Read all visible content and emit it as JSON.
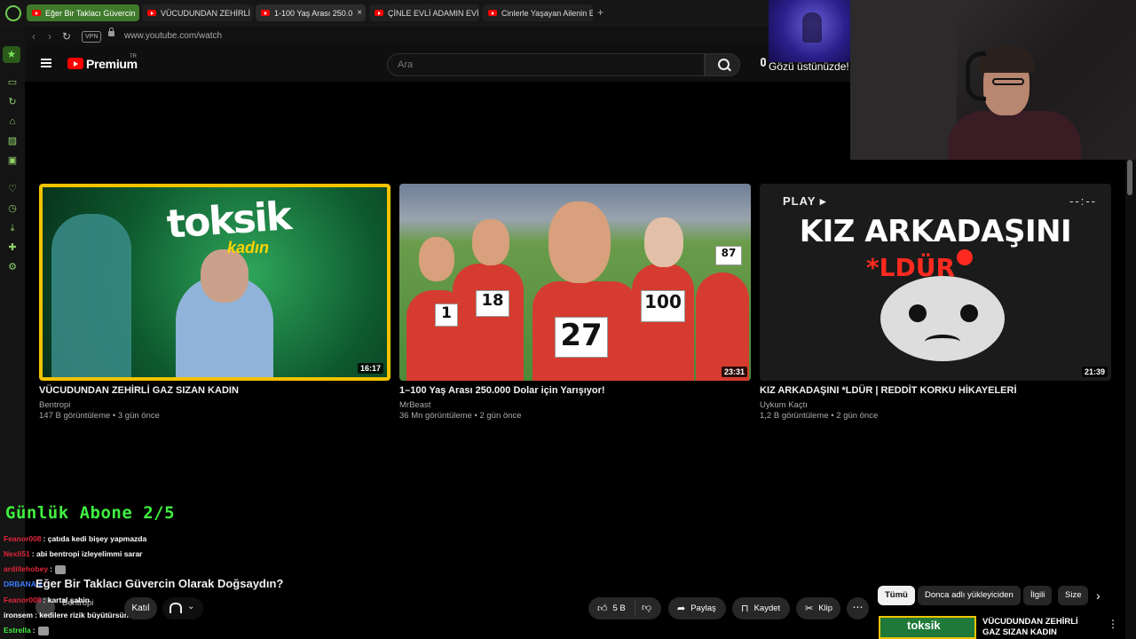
{
  "browser": {
    "tabs": [
      {
        "label": "Eğer Bir Taklacı Güvercin",
        "state": "green"
      },
      {
        "label": "VÜCUDUNDAN ZEHİRLİ G",
        "state": "normal"
      },
      {
        "label": "1-100 Yaş Arası 250.0",
        "state": "active"
      },
      {
        "label": "ÇİNLE EVLİ ADAMIN EVİN",
        "state": "normal"
      },
      {
        "label": "Cinlerle Yaşayan Ailenin E",
        "state": "normal"
      }
    ],
    "close_glyph": "×",
    "new_tab_glyph": "+",
    "vpn_label": "VPN",
    "url": "www.youtube.com/watch"
  },
  "youtube": {
    "logo_text": "Premium",
    "logo_region": "TR",
    "search_placeholder": "Ara"
  },
  "stream_overlay": {
    "caption": "Gözü üstünüzde!",
    "sub_goal": "Günlük Abone 2/5",
    "chat": [
      {
        "user": "Feanor008",
        "color": "#e0263a",
        "message": ": çatıda kedi bişey yapmazda"
      },
      {
        "user": "Nexli51",
        "color": "#e0263a",
        "message": ": abi bentropi izleyelimmi sarar"
      },
      {
        "user": "ardillehobey",
        "color": "#e0263a",
        "message": ":"
      },
      {
        "user": "DRBANAN",
        "color": "#3b7bff",
        "message": ""
      },
      {
        "user": "Feanor008",
        "color": "#e0263a",
        "message": ": kartal şahin"
      },
      {
        "user": "ironsem",
        "color": "#ffffff",
        "message": ": kedilere rizik büyütürsün"
      },
      {
        "user": "Estrella",
        "color": "#3ff03f",
        "message": ":"
      }
    ]
  },
  "videos": [
    {
      "title": "VÜCUDUNDAN ZEHİRLİ GAZ SIZAN KADIN",
      "channel": "Bentropi",
      "meta": "147 B görüntüleme • 3 gün önce",
      "duration": "16:17",
      "art_text": "toksik",
      "art_sub": "kadın"
    },
    {
      "title": "1–100 Yaş Arası 250.000 Dolar için Yarışıyor!",
      "channel": "MrBeast",
      "meta": "36 Mn görüntüleme • 2 gün önce",
      "duration": "23:31",
      "bibs": [
        "1",
        "18",
        "27",
        "100",
        "87"
      ]
    },
    {
      "title": "KIZ ARKADAŞINI *LDÜR | REDDİT KORKU HİKAYELERİ",
      "channel": "Uykum Kaçtı",
      "meta": "1,2 B görüntüleme • 2 gün önce",
      "duration": "21:39",
      "art_play": "PLAY ▸",
      "art_dots": "--:--",
      "art_big": "KIZ ARKADAŞINI",
      "art_red": "*LDÜR"
    }
  ],
  "player": {
    "title": "Eğer Bir Taklacı Güvercin Olarak Doğsaydın?",
    "channel_name": "Bentropi",
    "join_label": "Katıl",
    "like_count": "5 B",
    "share_label": "Paylaş",
    "save_label": "Kaydet",
    "clip_label": "Klip",
    "more_label": "⋯"
  },
  "chips": [
    {
      "label": "Tümü",
      "active": true
    },
    {
      "label": "Donca adlı yükleyiciden",
      "active": false
    },
    {
      "label": "İlgili",
      "active": false
    },
    {
      "label": "Size",
      "active": false
    }
  ],
  "recommendation": {
    "title": "VÜCUDUNDAN ZEHİRLİ GAZ SIZAN KADIN",
    "thumb_text": "toksik"
  }
}
